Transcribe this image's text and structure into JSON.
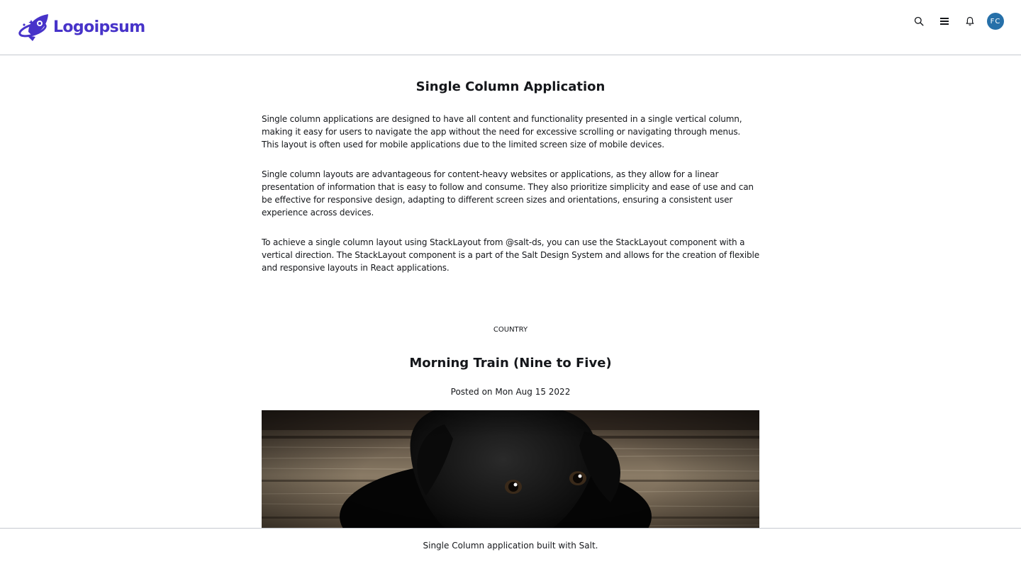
{
  "header": {
    "logo_text": "Logoipsum",
    "avatar_initials": "FC",
    "icons": [
      "search-icon",
      "menu-icon",
      "bell-icon"
    ]
  },
  "main": {
    "title": "Single Column Application",
    "paragraphs": [
      "Single column applications are designed to have all content and functionality presented in a single vertical column, making it easy for users to navigate the app without the need for excessive scrolling or navigating through menus. This layout is often used for mobile applications due to the limited screen size of mobile devices.",
      "Single column layouts are advantageous for content-heavy websites or applications, as they allow for a linear presentation of information that is easy to follow and consume. They also prioritize simplicity and ease of use and can be effective for responsive design, adapting to different screen sizes and orientations, ensuring a consistent user experience across devices.",
      "To achieve a single column layout using StackLayout from @salt-ds, you can use the StackLayout component with a vertical direction. The StackLayout component is a part of the Salt Design System and allows for the creation of flexible and responsive layouts in React applications."
    ]
  },
  "post": {
    "category": "COUNTRY",
    "title": "Morning Train (Nine to Five)",
    "date": "Posted on Mon Aug 15 2022"
  },
  "footer": {
    "text": "Single Column application built with Salt."
  },
  "colors": {
    "brand": "#4733c9",
    "avatar": "#2670a9",
    "divider": "#c5c9d0"
  }
}
